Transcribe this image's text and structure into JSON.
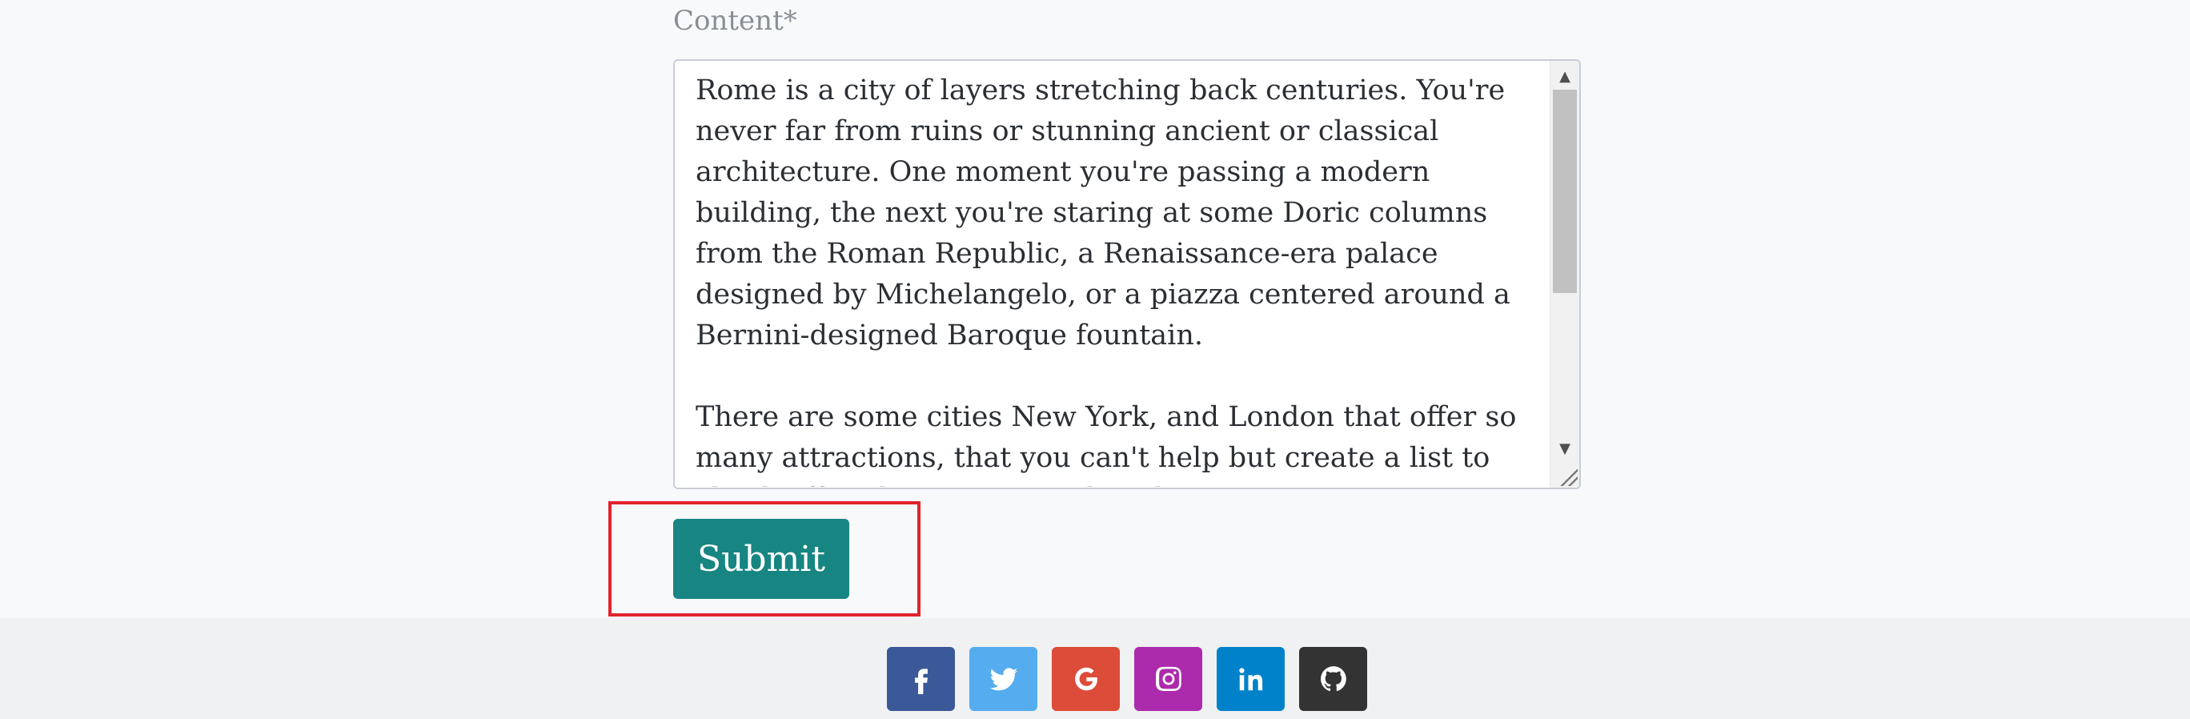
{
  "form": {
    "content_label": "Content*",
    "content_value": "Rome is a city of layers stretching back centuries. You're never far from ruins or stunning ancient or classical architecture. One moment you're passing a modern building, the next you're staring at some Doric columns from the Roman Republic, a Renaissance-era palace designed by Michelangelo, or a piazza centered around a Bernini-designed Baroque fountain.\n\nThere are some cities New York, and London that offer so many attractions, that you can't help but create a list to check off, it doesn't matter how long you're",
    "submit_label": "Submit"
  },
  "footer": {
    "social": [
      {
        "name": "facebook-icon",
        "color": "#3b5998"
      },
      {
        "name": "twitter-icon",
        "color": "#55acee"
      },
      {
        "name": "google-icon",
        "color": "#dd4b39"
      },
      {
        "name": "instagram-icon",
        "color": "#ac2bac"
      },
      {
        "name": "linkedin-icon",
        "color": "#0082ca"
      },
      {
        "name": "github-icon",
        "color": "#333333"
      }
    ]
  },
  "colors": {
    "accent": "#178582",
    "highlight": "#e0232b"
  }
}
